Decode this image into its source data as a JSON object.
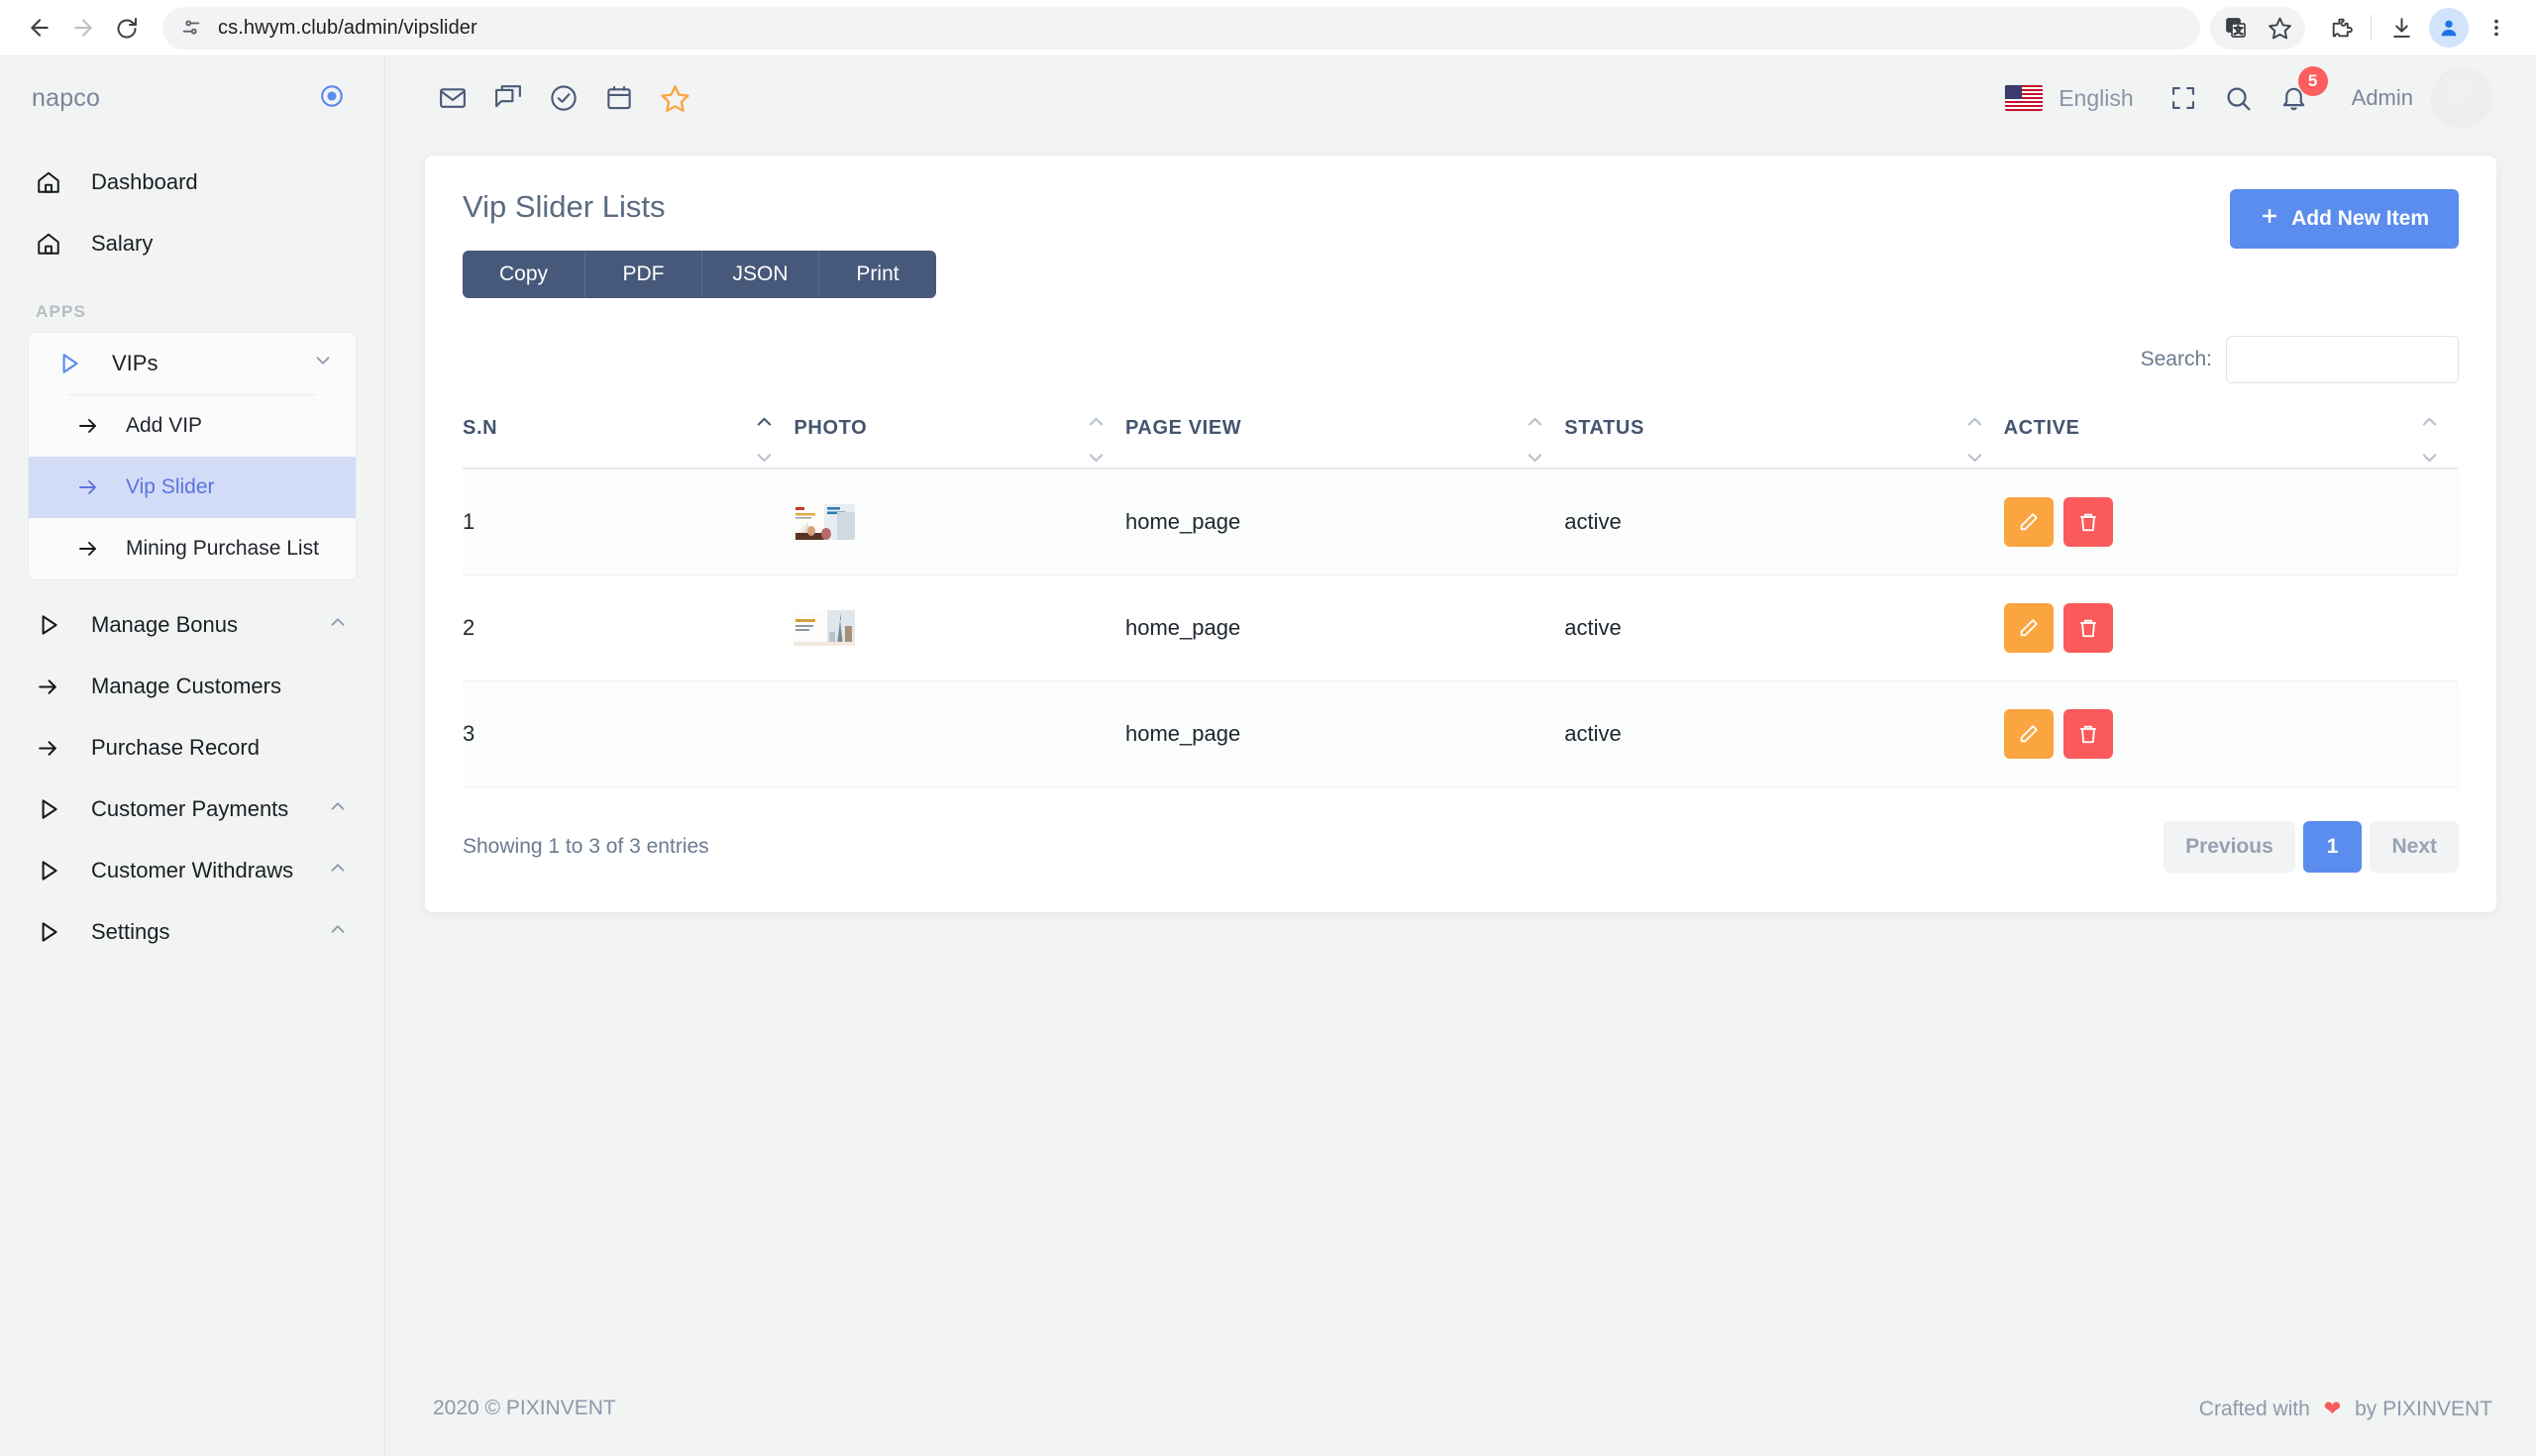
{
  "browser": {
    "url": "cs.hwym.club/admin/vipslider",
    "back_icon": "back-arrow-icon",
    "forward_icon": "forward-arrow-icon",
    "reload_icon": "reload-icon",
    "site_info_icon": "site-settings-icon",
    "translate_icon": "translate-icon",
    "bookmark_icon": "star-icon",
    "extensions_icon": "puzzle-piece-icon",
    "downloads_icon": "download-icon",
    "profile_icon": "profile-avatar-icon",
    "menu_icon": "three-dot-menu-icon"
  },
  "sidebar": {
    "brand": "napco",
    "pin_icon": "circle-target-icon",
    "top_items": [
      {
        "label": "Dashboard",
        "icon": "home-icon"
      },
      {
        "label": "Salary",
        "icon": "home-icon"
      }
    ],
    "section_title": "APPS",
    "group": {
      "label": "VIPs",
      "icon": "play-triangle-icon",
      "caret": "chevron-down-icon",
      "children": [
        {
          "label": "Add VIP",
          "icon": "arrow-right-icon",
          "active": false
        },
        {
          "label": "Vip Slider",
          "icon": "arrow-right-icon",
          "active": true
        },
        {
          "label": "Mining Purchase List",
          "icon": "arrow-right-icon",
          "active": false
        }
      ]
    },
    "bottom_items": [
      {
        "label": "Manage Bonus",
        "icon": "play-triangle-icon",
        "caret": "chevron-up-icon"
      },
      {
        "label": "Manage Customers",
        "icon": "arrow-right-icon",
        "caret": ""
      },
      {
        "label": "Purchase Record",
        "icon": "arrow-right-icon",
        "caret": ""
      },
      {
        "label": "Customer Payments",
        "icon": "play-triangle-icon",
        "caret": "chevron-up-icon"
      },
      {
        "label": "Customer Withdraws",
        "icon": "play-triangle-icon",
        "caret": "chevron-up-icon"
      },
      {
        "label": "Settings",
        "icon": "play-triangle-icon",
        "caret": "chevron-up-icon"
      }
    ]
  },
  "topbar": {
    "icons": [
      "mail-icon",
      "chat-icon",
      "check-circle-icon",
      "calendar-icon",
      "star-icon"
    ],
    "language": "English",
    "flag": "us-flag-icon",
    "fullscreen_icon": "fullscreen-icon",
    "search_icon": "search-icon",
    "bell_icon": "bell-icon",
    "notification_count": "5",
    "user_name": "Admin"
  },
  "page": {
    "title": "Vip Slider Lists",
    "add_button": "Add New Item",
    "add_button_icon": "plus-icon",
    "export_buttons": [
      "Copy",
      "PDF",
      "JSON",
      "Print"
    ],
    "search_label": "Search:",
    "search_value": "",
    "search_placeholder": "",
    "columns": [
      "S.N",
      "PHOTO",
      "PAGE VIEW",
      "STATUS",
      "ACTIVE"
    ],
    "rows": [
      {
        "sn": "1",
        "photo": "thumbnail-brochure-man",
        "page_view": "home_page",
        "status": "active"
      },
      {
        "sn": "2",
        "photo": "thumbnail-city-tower",
        "page_view": "home_page",
        "status": "active"
      },
      {
        "sn": "3",
        "photo": "",
        "page_view": "home_page",
        "status": "active"
      }
    ],
    "row_actions": {
      "edit_icon": "pencil-icon",
      "delete_icon": "trash-icon"
    },
    "entries_info": "Showing 1 to 3 of 3 entries",
    "pagination": {
      "previous": "Previous",
      "current": "1",
      "next": "Next"
    }
  },
  "footer": {
    "copyright": "2020 © PIXINVENT",
    "crafted_prefix": "Crafted with",
    "heart_icon": "heart-icon",
    "crafted_suffix": "by PIXINVENT"
  },
  "colors": {
    "accent": "#5a8dee",
    "dark_button": "#47597a",
    "edit": "#fba540",
    "delete": "#fa5a5a",
    "active_nav": "#d3dcf7"
  }
}
